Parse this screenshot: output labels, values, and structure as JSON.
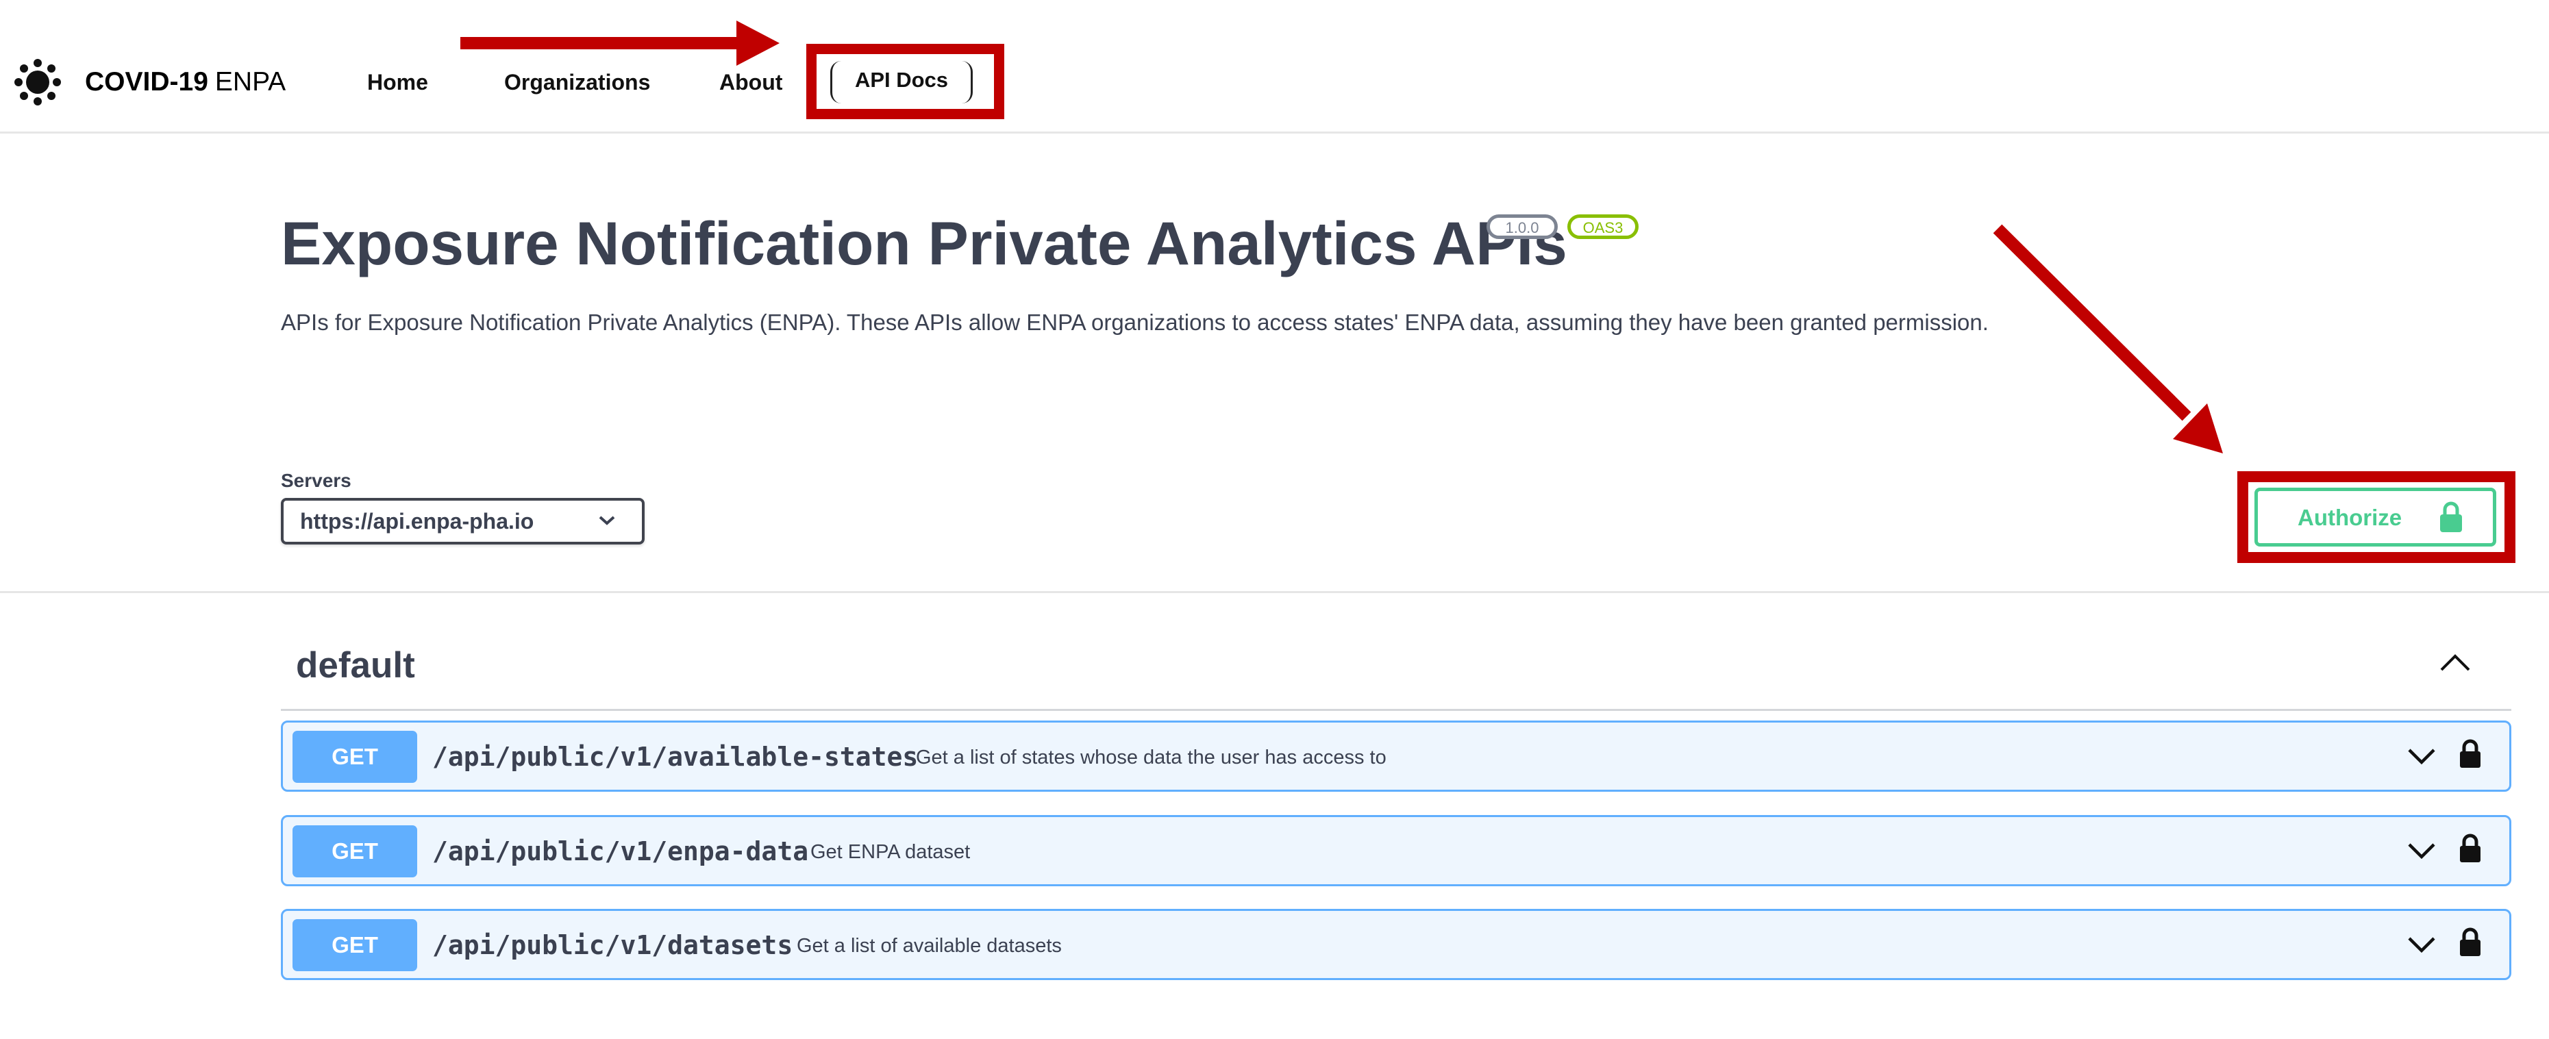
{
  "nav": {
    "brand_bold": "COVID-19",
    "brand_thin": "ENPA",
    "links": [
      "Home",
      "Organizations",
      "About"
    ],
    "api_docs_label": "API Docs"
  },
  "info": {
    "title": "Exposure Notification Private Analytics APIs",
    "badges": {
      "version": "1.0.0",
      "oas": "OAS3"
    },
    "description": "APIs for Exposure Notification Private Analytics (ENPA). These APIs allow ENPA organizations to access states' ENPA data, assuming they have been granted permission."
  },
  "servers": {
    "label": "Servers",
    "selected": "https://api.enpa-pha.io"
  },
  "authorize": {
    "label": "Authorize"
  },
  "tag": {
    "name": "default"
  },
  "operations": [
    {
      "method": "GET",
      "path": "/api/public/v1/available-states",
      "summary": "Get a list of states whose data the user has access to"
    },
    {
      "method": "GET",
      "path": "/api/public/v1/enpa-data",
      "summary": "Get ENPA dataset"
    },
    {
      "method": "GET",
      "path": "/api/public/v1/datasets",
      "summary": "Get a list of available datasets"
    }
  ],
  "colors": {
    "highlight": "#c00000",
    "get_method": "#61affe",
    "authorize": "#49cc90"
  },
  "icons": [
    "virus-logo-icon",
    "chevron-down-icon",
    "chevron-up-icon",
    "lock-icon"
  ]
}
